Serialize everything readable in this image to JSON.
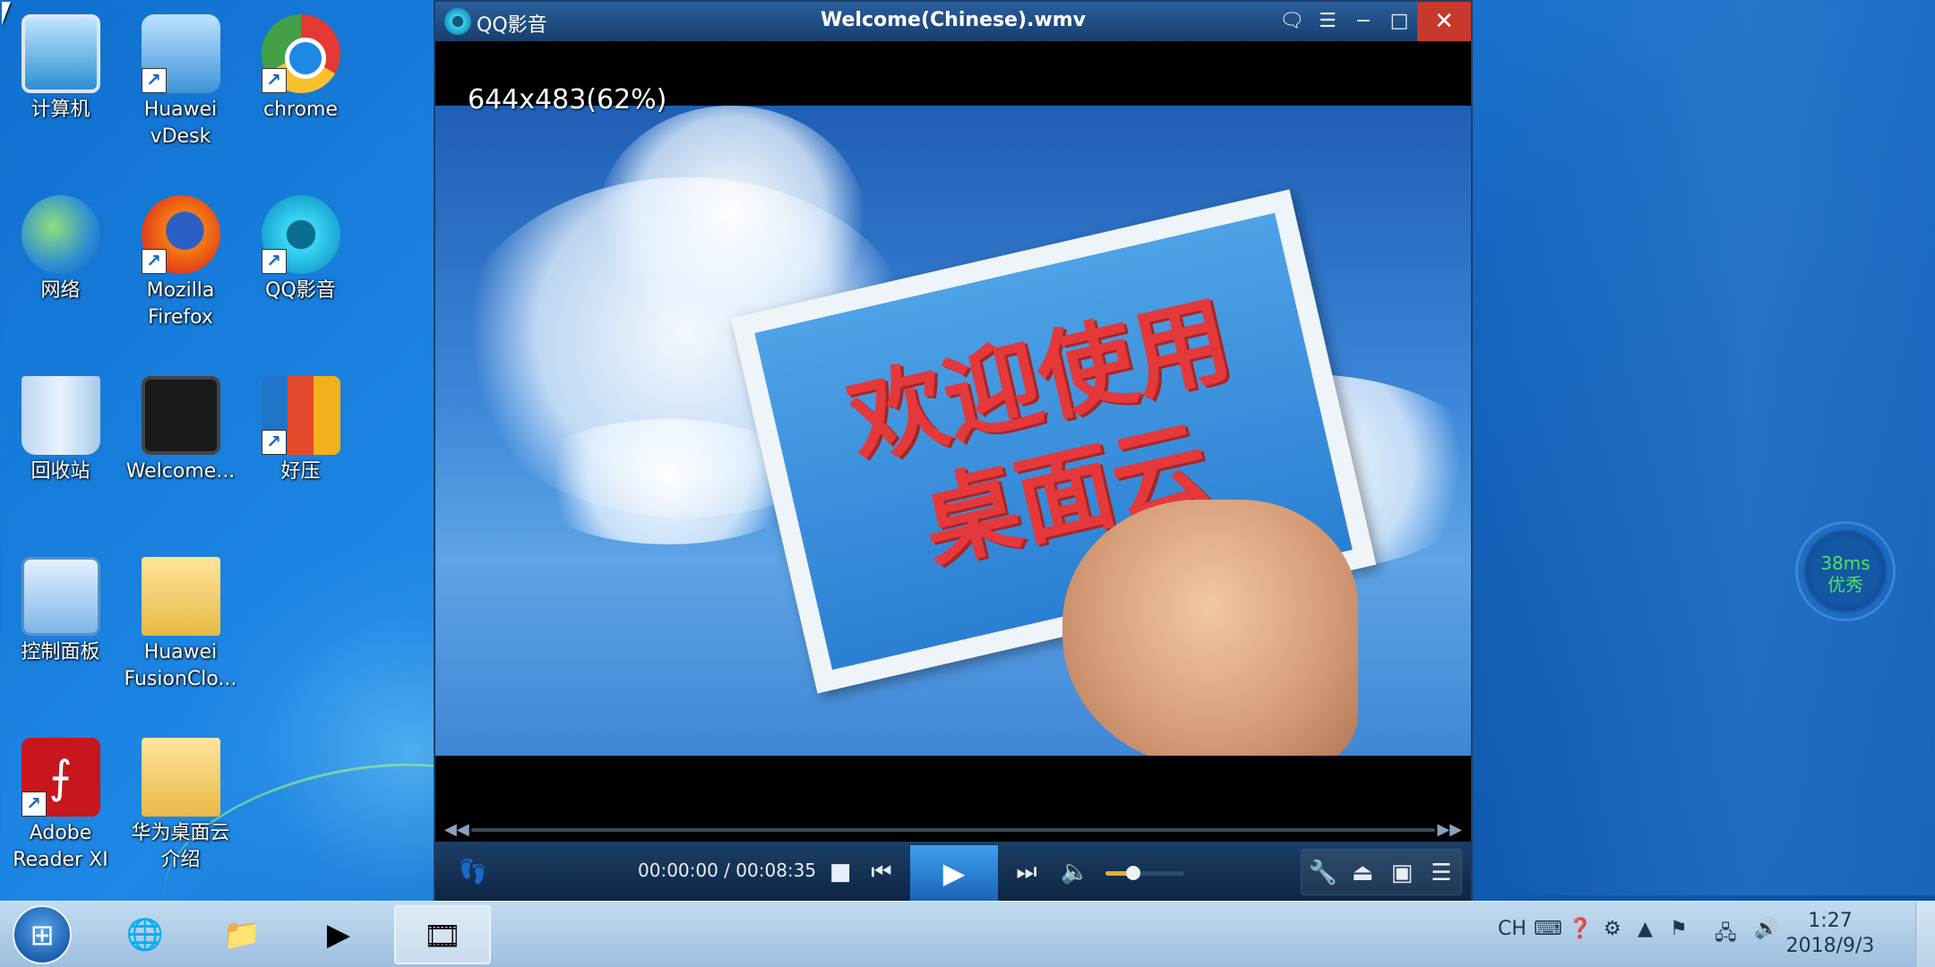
{
  "desktop": {
    "icons": [
      {
        "label": "计算机"
      },
      {
        "label": "Huawei vDesk"
      },
      {
        "label": "chrome"
      },
      {
        "label": "网络"
      },
      {
        "label": "Mozilla Firefox"
      },
      {
        "label": "QQ影音"
      },
      {
        "label": "回收站"
      },
      {
        "label": "Welcome..."
      },
      {
        "label": "好压"
      },
      {
        "label": "控制面板"
      },
      {
        "label": "Huawei FusionClo..."
      },
      {
        "label": "Adobe Reader XI"
      },
      {
        "label": "华为桌面云介绍"
      }
    ]
  },
  "player": {
    "app_name": "QQ影音",
    "file_name": "Welcome(Chinese).wmv",
    "resolution_overlay": "644x483(62%)",
    "video_text_line1": "欢迎使用",
    "video_text_line2": "桌面云",
    "time_display": "00:00:00 / 00:08:35",
    "volume_level": 0.35,
    "seek_progress": 0.0
  },
  "latency": {
    "value": "38ms",
    "rating": "优秀",
    "color": "#52e05a"
  },
  "taskbar": {
    "language": "CH",
    "time": "1:27",
    "date": "2018/9/3"
  }
}
